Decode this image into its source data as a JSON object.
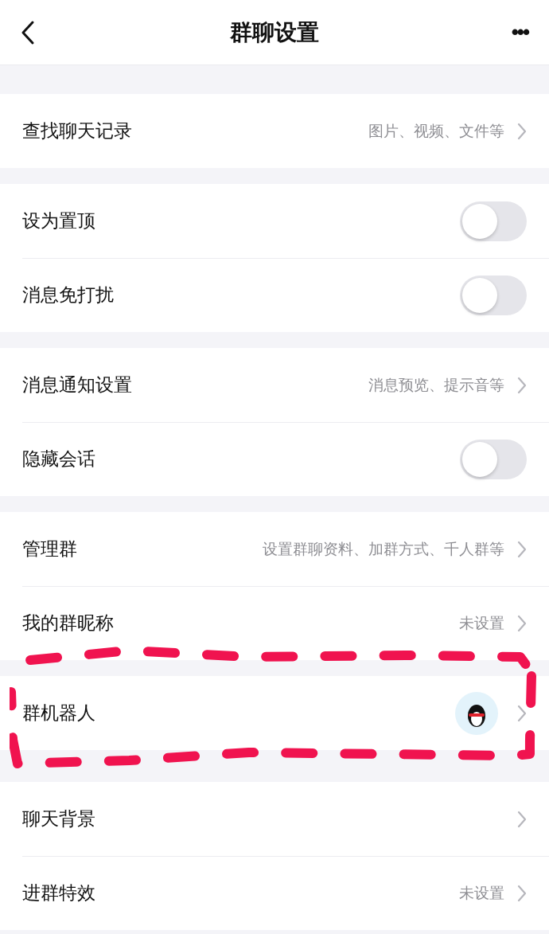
{
  "header": {
    "title": "群聊设置",
    "more": "•••"
  },
  "sections": [
    {
      "highlighted": false,
      "items": [
        {
          "kind": "link",
          "label": "查找聊天记录",
          "value": "图片、视频、文件等"
        }
      ]
    },
    {
      "highlighted": false,
      "items": [
        {
          "kind": "toggle",
          "label": "设为置顶",
          "on": false
        },
        {
          "kind": "toggle",
          "label": "消息免打扰",
          "on": false
        }
      ]
    },
    {
      "highlighted": false,
      "items": [
        {
          "kind": "link",
          "label": "消息通知设置",
          "value": "消息预览、提示音等"
        },
        {
          "kind": "toggle",
          "label": "隐藏会话",
          "on": false
        }
      ]
    },
    {
      "highlighted": false,
      "items": [
        {
          "kind": "link",
          "label": "管理群",
          "value": "设置群聊资料、加群方式、千人群等"
        },
        {
          "kind": "link",
          "label": "我的群昵称",
          "value": "未设置"
        }
      ]
    },
    {
      "highlighted": true,
      "items": [
        {
          "kind": "avatar",
          "label": "群机器人"
        }
      ]
    },
    {
      "highlighted": false,
      "items": [
        {
          "kind": "link",
          "label": "聊天背景"
        },
        {
          "kind": "link",
          "label": "进群特效",
          "value": "未设置"
        }
      ]
    }
  ]
}
